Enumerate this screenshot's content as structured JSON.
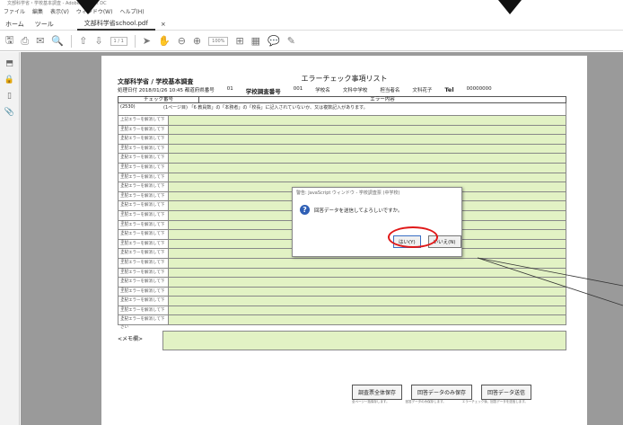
{
  "window": {
    "title": "文部科学省・学校基本調査 - Adobe Acrobat DC"
  },
  "menu": [
    "ファイル",
    "編集",
    "表示(V)",
    "ウィンドウ(W)",
    "ヘルプ(H)"
  ],
  "tabs": {
    "home": "ホーム",
    "tools": "ツール",
    "document": "文部科学省school.pdf"
  },
  "toolbar": {
    "page_indicator": "1 / 1",
    "zoom": "100%"
  },
  "form": {
    "title": "エラーチェック事項リスト",
    "org": "文部科学省 / 学校基本調査",
    "processing": "処理日付 2018/01/26 10:45 都道府県番号",
    "pref_no": "01",
    "survey_label": "学校調査番号",
    "survey_no": "001",
    "school_label": "学校名",
    "school_name": "文科中学校",
    "person_label": "担当者名",
    "person_name": "文科花子",
    "tel_label": "Tel",
    "tel": "00000000",
    "col_check": "チェック番号",
    "col_error": "エラー内容",
    "first_check_no": "(2530)",
    "first_error": "(1ページ目) 「6 教員数」の「本務者」の「校長」に記入されていないか、又は複数記入があります。",
    "row_label": "上記エラーを解消して下さい",
    "memo_label": "<メモ欄>",
    "buttons": [
      "調査票全体保存",
      "回答データのみ保存",
      "回答データ送信"
    ],
    "notes": [
      "全ページ一括保存します。",
      "回答データのみ保存します。",
      "エラーチェック後、回答データを送信します。"
    ]
  },
  "dialog": {
    "title": "警告: JavaScript ウィンドウ - 学校調査票 (中学校)",
    "message": "回答データを送信してよろしいですか。",
    "yes": "はい(Y)",
    "no": "いいえ(N)"
  },
  "rows": 22
}
